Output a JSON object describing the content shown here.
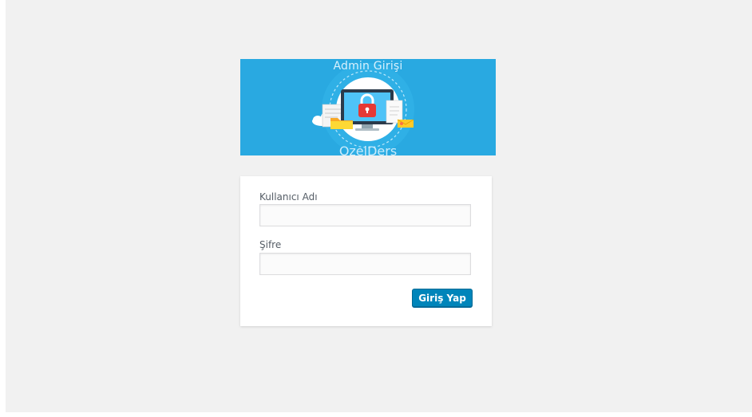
{
  "banner": {
    "title": "Admin Girişi",
    "footer": "OzelDers"
  },
  "form": {
    "username": {
      "label": "Kullanıcı Adı",
      "value": ""
    },
    "password": {
      "label": "Şifre",
      "value": ""
    },
    "submit_label": "Giriş Yap"
  },
  "colors": {
    "page_background": "#f1f1f1",
    "banner_background": "#29a9e1",
    "button": "#0085ba"
  }
}
